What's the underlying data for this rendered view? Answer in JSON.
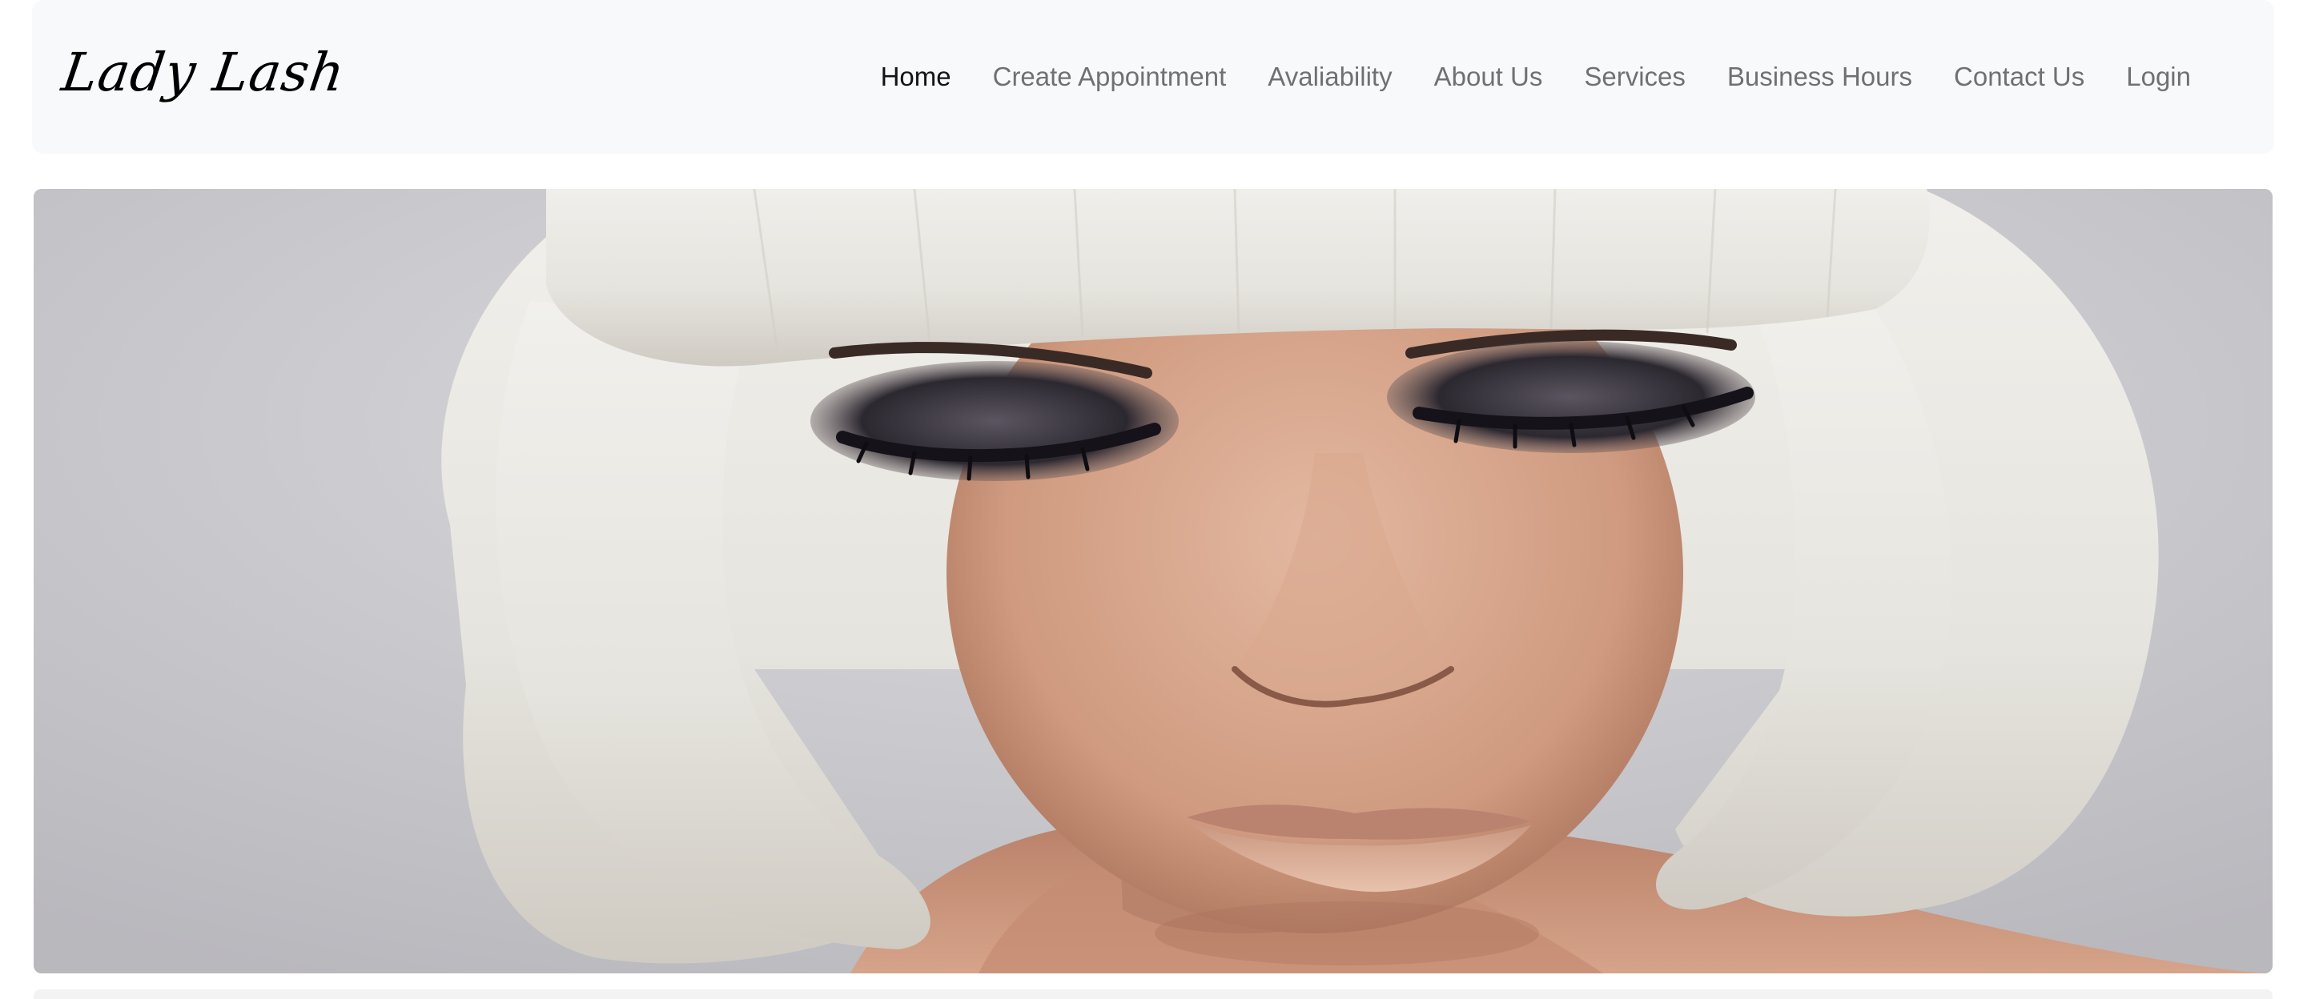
{
  "navbar": {
    "brand": "Lady Lash",
    "links": [
      {
        "label": "Home",
        "active": true
      },
      {
        "label": "Create Appointment",
        "active": false
      },
      {
        "label": "Avaliability",
        "active": false
      },
      {
        "label": "About Us",
        "active": false
      },
      {
        "label": "Services",
        "active": false
      },
      {
        "label": "Business Hours",
        "active": false
      },
      {
        "label": "Contact Us",
        "active": false
      },
      {
        "label": "Login",
        "active": false
      }
    ]
  },
  "hero": {
    "image_subject": "portrait-woman-white-bob-smoky-eyes"
  },
  "colors": {
    "navbar_bg": "#f8f9fa",
    "link_active": "#000000",
    "link_inactive": "#6c6c6c",
    "skin": "#d8a88c",
    "hair": "#ecebe6",
    "backdrop": "#cfcfd4"
  }
}
